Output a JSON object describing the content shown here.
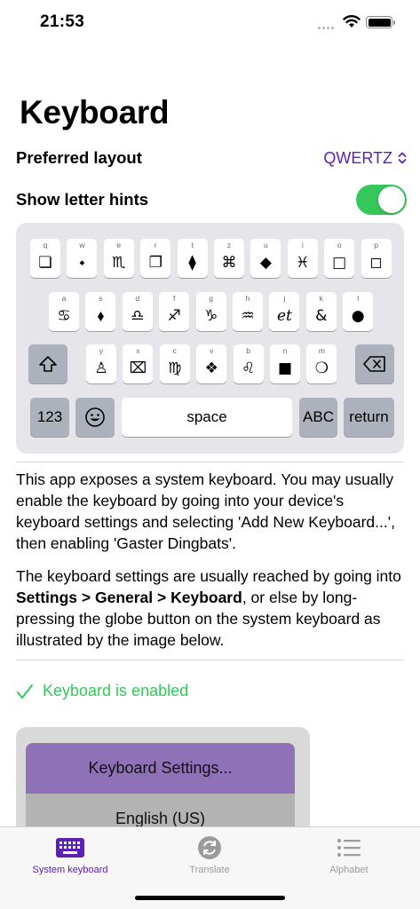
{
  "status": {
    "time": "21:53"
  },
  "title": "Keyboard",
  "settings": {
    "layout_label": "Preferred layout",
    "layout_value": "QWERTZ",
    "hints_label": "Show letter hints",
    "hints_on": true
  },
  "keyboard": {
    "row1": [
      {
        "hint": "q",
        "glyph": "❏"
      },
      {
        "hint": "w",
        "glyph": "⬩"
      },
      {
        "hint": "e",
        "glyph": "♏"
      },
      {
        "hint": "r",
        "glyph": "❐"
      },
      {
        "hint": "t",
        "glyph": "⧫"
      },
      {
        "hint": "z",
        "glyph": "⌘"
      },
      {
        "hint": "u",
        "glyph": "◆"
      },
      {
        "hint": "i",
        "glyph": "♓"
      },
      {
        "hint": "o",
        "glyph": "□"
      },
      {
        "hint": "p",
        "glyph": "◻"
      }
    ],
    "row2": [
      {
        "hint": "a",
        "glyph": "♋"
      },
      {
        "hint": "s",
        "glyph": "⬧"
      },
      {
        "hint": "d",
        "glyph": "♎"
      },
      {
        "hint": "f",
        "glyph": "♐"
      },
      {
        "hint": "g",
        "glyph": "♑"
      },
      {
        "hint": "h",
        "glyph": "♒"
      },
      {
        "hint": "j",
        "glyph": "et"
      },
      {
        "hint": "k",
        "glyph": "&"
      },
      {
        "hint": "l",
        "glyph": "●"
      }
    ],
    "row3": [
      {
        "hint": "y",
        "glyph": "♙"
      },
      {
        "hint": "x",
        "glyph": "⌧"
      },
      {
        "hint": "c",
        "glyph": "♍"
      },
      {
        "hint": "v",
        "glyph": "❖"
      },
      {
        "hint": "b",
        "glyph": "♌"
      },
      {
        "hint": "n",
        "glyph": "■"
      },
      {
        "hint": "m",
        "glyph": "❍"
      }
    ],
    "numbers_label": "123",
    "space_label": "space",
    "abc_label": "ABC",
    "return_label": "return"
  },
  "description": {
    "para1": "This app exposes a system keyboard. You may usually enable the keyboard by going into your device's keyboard settings and selecting 'Add New Keyboard...', then enabling 'Gaster Dingbats'.",
    "para2_before": "The keyboard settings are usually reached by going into ",
    "para2_bold": "Settings > General > Keyboard",
    "para2_after": ", or else by long-pressing the globe button on the system keyboard as illustrated by the image below."
  },
  "status_message": "Keyboard is enabled",
  "illustration": {
    "item1": "Keyboard Settings...",
    "item2": "English (US)"
  },
  "tabs": [
    {
      "label": "System keyboard",
      "icon": "keyboard-icon",
      "active": true
    },
    {
      "label": "Translate",
      "icon": "translate-icon",
      "active": false
    },
    {
      "label": "Alphabet",
      "icon": "list-icon",
      "active": false
    }
  ],
  "colors": {
    "accent": "#5b21b6",
    "success": "#34c759",
    "keyboard_bg": "#e5e5ea"
  }
}
